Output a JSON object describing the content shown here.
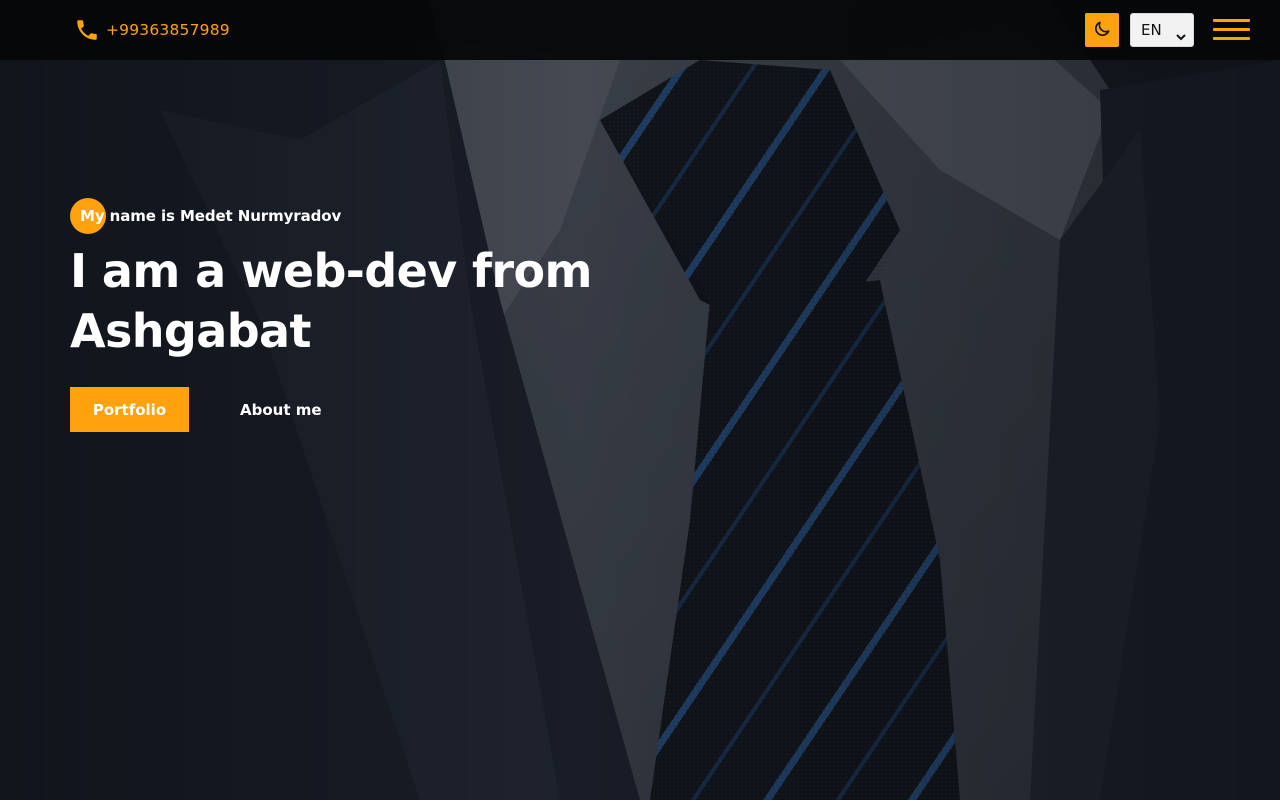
{
  "header": {
    "phone_icon": "phone-icon",
    "phone_number": "+99363857989",
    "theme_toggle_icon": "moon-icon",
    "language": {
      "selected": "EN"
    },
    "menu_icon": "hamburger-menu-icon"
  },
  "hero": {
    "intro": "My name is Medet Nurmyradov",
    "headline": "I am a web-dev from Ashgabat",
    "primary_button": "Portfolio",
    "secondary_button": "About me"
  },
  "colors": {
    "accent": "#ffa20e",
    "topbar": "#050608",
    "text": "#ffffff"
  }
}
